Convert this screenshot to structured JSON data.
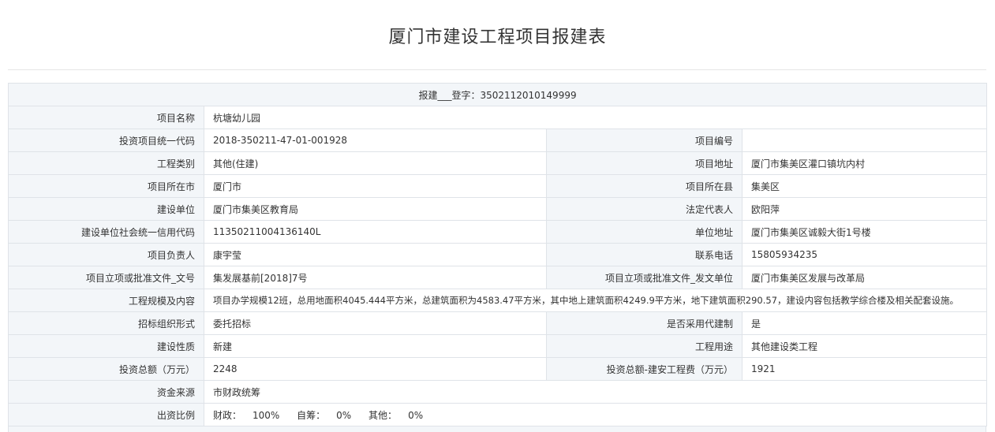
{
  "title": "厦门市建设工程项目报建表",
  "registration": "报建___登字：3502112010149999",
  "rows": {
    "project_name": {
      "label": "项目名称",
      "value": "杭塘幼儿园"
    },
    "invest_code": {
      "label": "投资项目统一代码",
      "value": "2018-350211-47-01-001928"
    },
    "project_no": {
      "label": "项目编号",
      "value": ""
    },
    "category": {
      "label": "工程类别",
      "value": "其他(住建)"
    },
    "address": {
      "label": "项目地址",
      "value": "厦门市集美区灌口镇坑内村"
    },
    "city": {
      "label": "项目所在市",
      "value": "厦门市"
    },
    "county": {
      "label": "项目所在县",
      "value": "集美区"
    },
    "builder": {
      "label": "建设单位",
      "value": "厦门市集美区教育局"
    },
    "legal_rep": {
      "label": "法定代表人",
      "value": "欧阳萍"
    },
    "credit_code": {
      "label": "建设单位社会统一信用代码",
      "value": "11350211004136140L"
    },
    "unit_address": {
      "label": "单位地址",
      "value": "厦门市集美区诚毅大街1号楼"
    },
    "leader": {
      "label": "项目负责人",
      "value": "康宇莹"
    },
    "phone": {
      "label": "联系电话",
      "value": "15805934235"
    },
    "approval_doc": {
      "label": "项目立项或批准文件_文号",
      "value": "集发展基前[2018]7号"
    },
    "approval_unit": {
      "label": "项目立项或批准文件_发文单位",
      "value": "厦门市集美区发展与改革局"
    },
    "scale": {
      "label": "工程规模及内容",
      "value": "项目办学规模12班，总用地面积4045.444平方米，总建筑面积为4583.47平方米，其中地上建筑面积4249.9平方米，地下建筑面积290.57，建设内容包括教学综合楼及相关配套设施。"
    },
    "bidding": {
      "label": "招标组织形式",
      "value": "委托招标"
    },
    "agent": {
      "label": "是否采用代建制",
      "value": "是"
    },
    "nature": {
      "label": "建设性质",
      "value": "新建"
    },
    "usage": {
      "label": "工程用途",
      "value": "其他建设类工程"
    },
    "total_invest": {
      "label": "投资总额（万元）",
      "value": "2248"
    },
    "install_cost": {
      "label": "投资总额-建安工程费（万元）",
      "value": "1921"
    },
    "fund_source": {
      "label": "资金来源",
      "value": "市财政统筹"
    },
    "ratio": {
      "label": "出资比例",
      "finance_label": "财政：",
      "finance_value": "100%",
      "self_label": "自筹：",
      "self_value": "0%",
      "other_label": "其他：",
      "other_value": "0%"
    }
  }
}
